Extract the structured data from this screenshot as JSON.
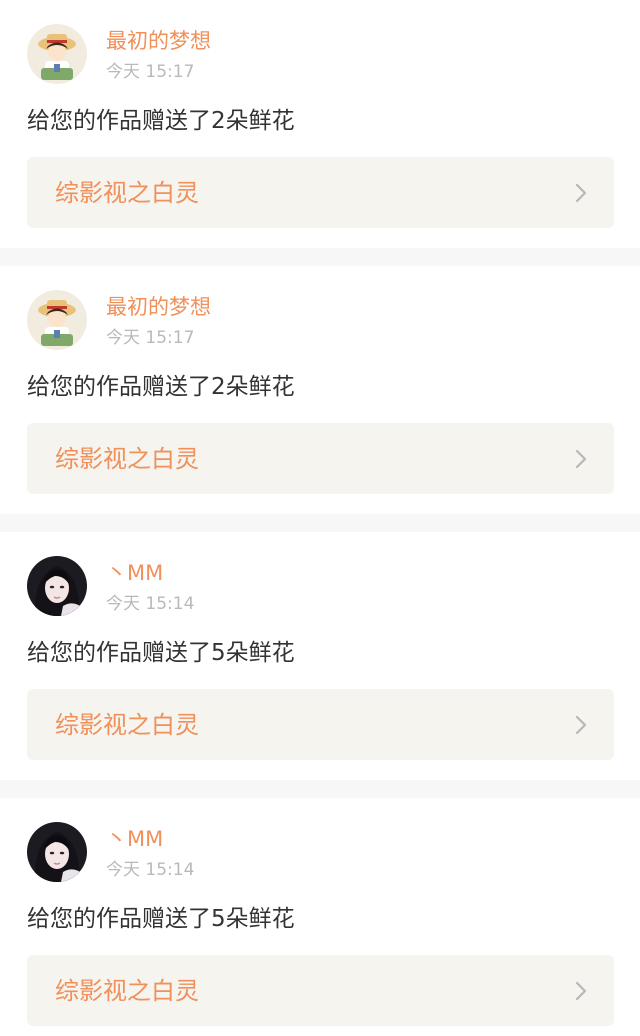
{
  "notifications": [
    {
      "username": "最初的梦想",
      "time": "今天 15:17",
      "avatar_icon": "cartoon-boy-avatar",
      "message": "给您的作品赠送了2朵鲜花",
      "work_title": "综影视之白灵"
    },
    {
      "username": "最初的梦想",
      "time": "今天 15:17",
      "avatar_icon": "cartoon-boy-avatar",
      "message": "给您的作品赠送了2朵鲜花",
      "work_title": "综影视之白灵"
    },
    {
      "username": "丶MM",
      "time": "今天 15:14",
      "avatar_icon": "girl-photo-avatar",
      "message": "给您的作品赠送了5朵鲜花",
      "work_title": "综影视之白灵"
    },
    {
      "username": "丶MM",
      "time": "今天 15:14",
      "avatar_icon": "girl-photo-avatar",
      "message": "给您的作品赠送了5朵鲜花",
      "work_title": "综影视之白灵"
    }
  ],
  "colors": {
    "accent": "#f0905a",
    "time": "#b9b9b9",
    "text": "#333333",
    "link_bg": "#f5f4ef",
    "page_bg": "#f7f7f7"
  }
}
